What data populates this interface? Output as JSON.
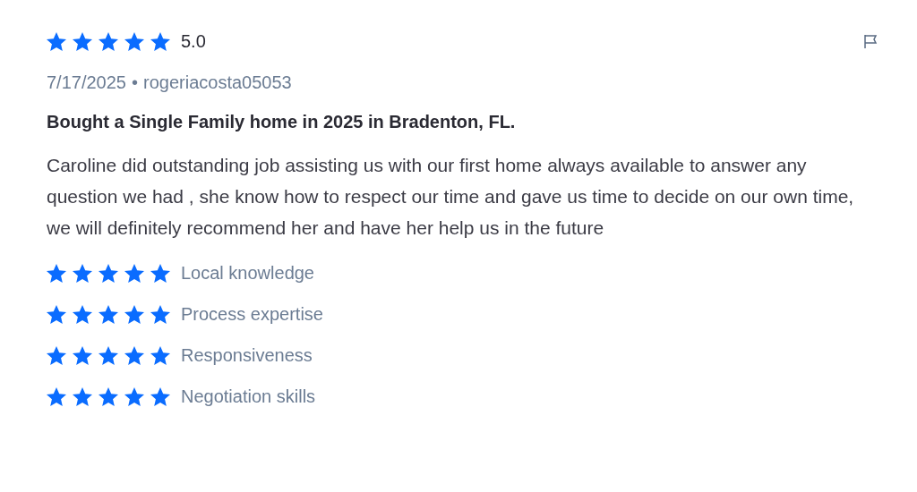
{
  "review": {
    "stars": 5,
    "rating": "5.0",
    "date": "7/17/2025",
    "separator": "•",
    "author": "rogeriacosta05053",
    "title": "Bought a Single Family home in 2025 in Bradenton, FL.",
    "body": "Caroline did outstanding job assisting us with our first home always available to answer any question we had , she know how to respect our time and gave us time to decide on our own time, we will definitely recommend her and have her help us in the future"
  },
  "sub_ratings": [
    {
      "label": "Local knowledge",
      "stars": 5
    },
    {
      "label": "Process expertise",
      "stars": 5
    },
    {
      "label": "Responsiveness",
      "stars": 5
    },
    {
      "label": "Negotiation skills",
      "stars": 5
    }
  ]
}
